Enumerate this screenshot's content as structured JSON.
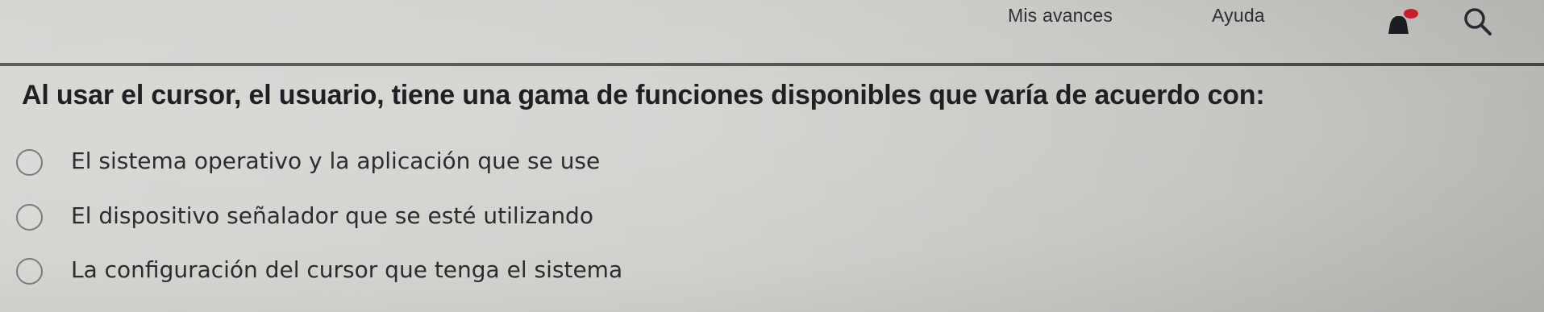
{
  "nav": {
    "progress_label": "Mis avances",
    "help_label": "Ayuda",
    "bell_icon": "bell-icon",
    "search_icon": "search-icon"
  },
  "question": {
    "text": "Al usar el cursor, el usuario, tiene una gama de funciones disponibles que varía de acuerdo con:"
  },
  "options": [
    {
      "label": "El sistema operativo y la aplicación que se use",
      "selected": false
    },
    {
      "label": "El dispositivo señalador que se esté utilizando",
      "selected": false
    },
    {
      "label": "La configuración del cursor que tenga el sistema",
      "selected": false
    }
  ],
  "colors": {
    "text": "#2b2c30",
    "divider": "#3d3d3d",
    "background": "#d2d0cd"
  }
}
